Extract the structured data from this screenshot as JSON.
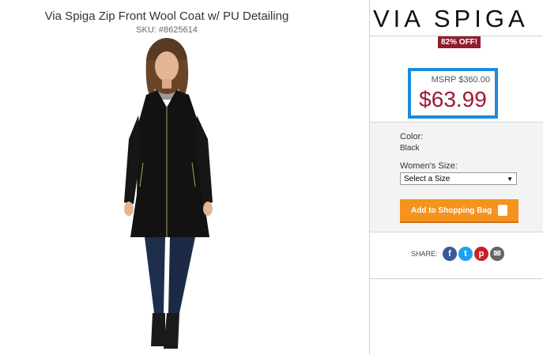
{
  "product": {
    "title": "Via Spiga Zip Front Wool Coat w/ PU Detailing",
    "sku": "SKU: #8625614"
  },
  "brand": {
    "name": "VIA SPIGA"
  },
  "pricing": {
    "badge": "82% OFF!",
    "msrp": "MSRP $360.00",
    "price": "$63.99",
    "highlight_color": "#1a8be0",
    "price_color": "#9b1b2f"
  },
  "options": {
    "color_label": "Color:",
    "color_value": "Black",
    "size_label": "Women's Size:",
    "size_selected": "Select a Size"
  },
  "actions": {
    "add_to_bag": "Add to Shopping Bag"
  },
  "share": {
    "label": "SHARE:",
    "icons": [
      "facebook-icon",
      "twitter-icon",
      "pinterest-icon",
      "email-icon"
    ]
  }
}
